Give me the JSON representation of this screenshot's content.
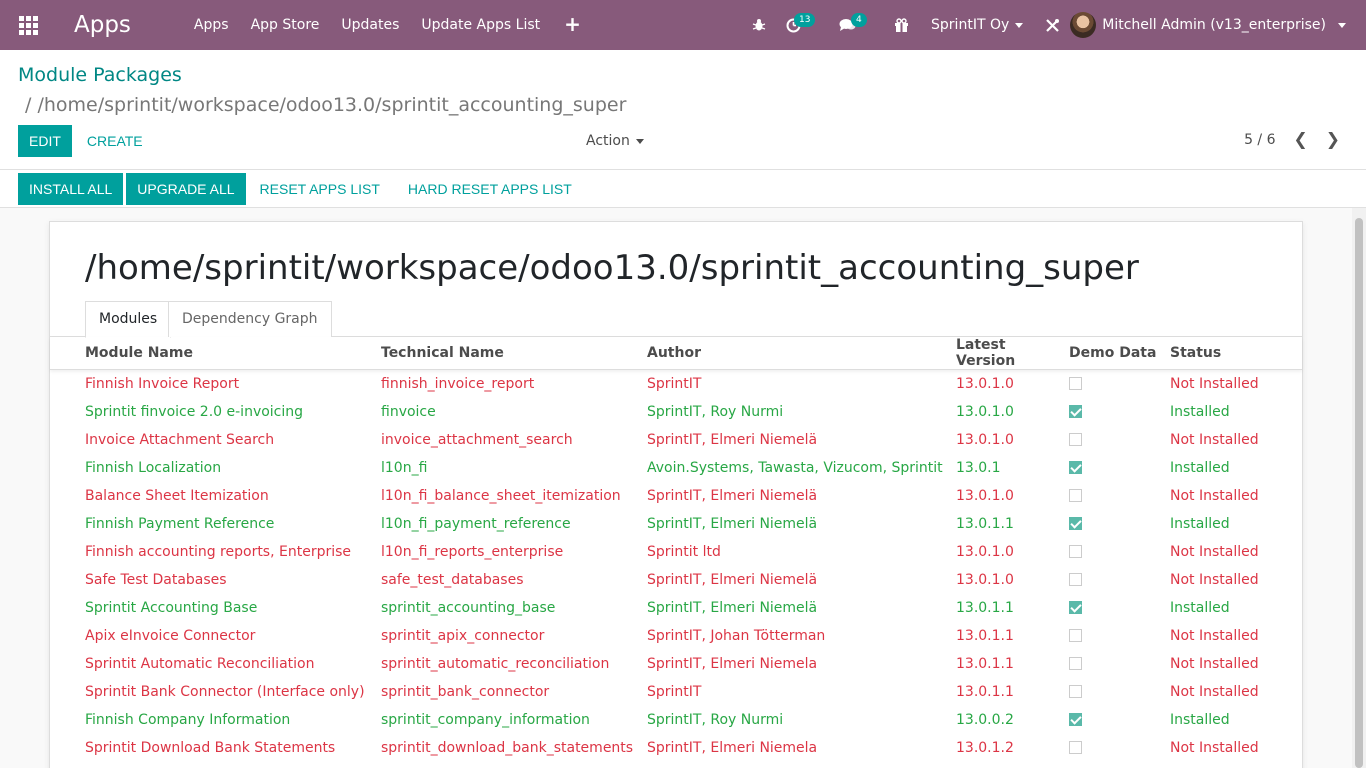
{
  "navbar": {
    "app_name": "Apps",
    "menu": [
      "Apps",
      "App Store",
      "Updates",
      "Update Apps List"
    ],
    "plus": "+",
    "activity_count": "13",
    "message_count": "4",
    "company": "SprintIT Oy",
    "user": "Mitchell Admin (v13_enterprise)",
    "colors": {
      "bar": "#875a7b",
      "badge": "#00a09d"
    }
  },
  "control_panel": {
    "breadcrumb_parent": "Module Packages",
    "breadcrumb_sep": "/",
    "breadcrumb_current": "/home/sprintit/workspace/odoo13.0/sprintit_accounting_super",
    "edit_label": "Edit",
    "create_label": "Create",
    "action_label": "Action",
    "pager": "5 / 6"
  },
  "statusbar": {
    "install_all": "Install All",
    "upgrade_all": "Upgrade All",
    "reset_apps_list": "Reset Apps List",
    "hard_reset_apps_list": "Hard Reset Apps List"
  },
  "sheet": {
    "title": "/home/sprintit/workspace/odoo13.0/sprintit_accounting_super",
    "tabs": [
      "Modules",
      "Dependency Graph"
    ]
  },
  "table": {
    "headers": [
      "Module Name",
      "Technical Name",
      "Author",
      "Latest Version",
      "Demo Data",
      "Status"
    ],
    "rows": [
      {
        "name": "Finnish Invoice Report",
        "technical": "finnish_invoice_report",
        "author": "SprintIT",
        "version": "13.0.1.0",
        "demo": false,
        "status": "Not Installed"
      },
      {
        "name": "Sprintit finvoice 2.0 e-invoicing",
        "technical": "finvoice",
        "author": "SprintIT, Roy Nurmi",
        "version": "13.0.1.0",
        "demo": true,
        "status": "Installed"
      },
      {
        "name": "Invoice Attachment Search",
        "technical": "invoice_attachment_search",
        "author": "SprintIT, Elmeri Niemelä",
        "version": "13.0.1.0",
        "demo": false,
        "status": "Not Installed"
      },
      {
        "name": "Finnish Localization",
        "technical": "l10n_fi",
        "author": "Avoin.Systems, Tawasta, Vizucom, Sprintit",
        "version": "13.0.1",
        "demo": true,
        "status": "Installed"
      },
      {
        "name": "Balance Sheet Itemization",
        "technical": "l10n_fi_balance_sheet_itemization",
        "author": "SprintIT, Elmeri Niemelä",
        "version": "13.0.1.0",
        "demo": false,
        "status": "Not Installed"
      },
      {
        "name": "Finnish Payment Reference",
        "technical": "l10n_fi_payment_reference",
        "author": "SprintIT, Elmeri Niemelä",
        "version": "13.0.1.1",
        "demo": true,
        "status": "Installed"
      },
      {
        "name": "Finnish accounting reports, Enterprise",
        "technical": "l10n_fi_reports_enterprise",
        "author": "Sprintit ltd",
        "version": "13.0.1.0",
        "demo": false,
        "status": "Not Installed"
      },
      {
        "name": "Safe Test Databases",
        "technical": "safe_test_databases",
        "author": "SprintIT, Elmeri Niemelä",
        "version": "13.0.1.0",
        "demo": false,
        "status": "Not Installed"
      },
      {
        "name": "Sprintit Accounting Base",
        "technical": "sprintit_accounting_base",
        "author": "SprintIT, Elmeri Niemelä",
        "version": "13.0.1.1",
        "demo": true,
        "status": "Installed"
      },
      {
        "name": "Apix eInvoice Connector",
        "technical": "sprintit_apix_connector",
        "author": "SprintIT, Johan Tötterman",
        "version": "13.0.1.1",
        "demo": false,
        "status": "Not Installed"
      },
      {
        "name": "Sprintit Automatic Reconciliation",
        "technical": "sprintit_automatic_reconciliation",
        "author": "SprintIT, Elmeri Niemela",
        "version": "13.0.1.1",
        "demo": false,
        "status": "Not Installed"
      },
      {
        "name": "Sprintit Bank Connector (Interface only)",
        "technical": "sprintit_bank_connector",
        "author": "SprintIT",
        "version": "13.0.1.1",
        "demo": false,
        "status": "Not Installed"
      },
      {
        "name": "Finnish Company Information",
        "technical": "sprintit_company_information",
        "author": "SprintIT, Roy Nurmi",
        "version": "13.0.0.2",
        "demo": true,
        "status": "Installed"
      },
      {
        "name": "Sprintit Download Bank Statements",
        "technical": "sprintit_download_bank_statements",
        "author": "SprintIT, Elmeri Niemela",
        "version": "13.0.1.2",
        "demo": false,
        "status": "Not Installed"
      }
    ]
  }
}
